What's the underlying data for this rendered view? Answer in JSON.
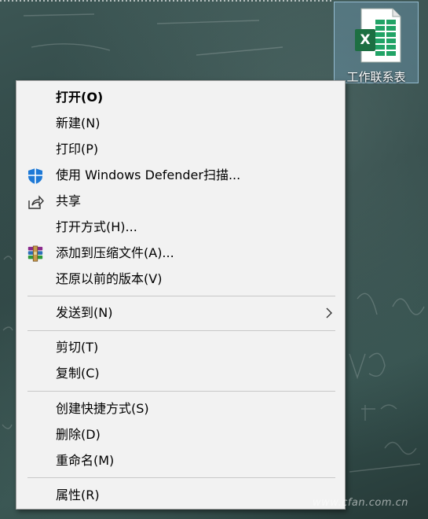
{
  "desktop": {
    "file_icon": {
      "label": "工作联系表",
      "icon": "excel-file-icon",
      "badge_letter": "X",
      "accent": "#1d6f42"
    }
  },
  "context_menu": {
    "items": [
      {
        "label": "打开(O)",
        "bold": true
      },
      {
        "label": "新建(N)"
      },
      {
        "label": "打印(P)"
      },
      {
        "label": "使用 Windows Defender扫描...",
        "icon": "windows-defender-shield-icon"
      },
      {
        "label": "共享",
        "icon": "share-icon"
      },
      {
        "label": "打开方式(H)..."
      },
      {
        "label": "添加到压缩文件(A)...",
        "icon": "winrar-icon"
      },
      {
        "label": "还原以前的版本(V)"
      },
      {
        "label": "发送到(N)",
        "submenu": true
      },
      {
        "label": "剪切(T)"
      },
      {
        "label": "复制(C)"
      },
      {
        "label": "创建快捷方式(S)"
      },
      {
        "label": "删除(D)"
      },
      {
        "label": "重命名(M)"
      },
      {
        "label": "属性(R)"
      }
    ]
  },
  "watermark": "www.cfan.com.cn"
}
